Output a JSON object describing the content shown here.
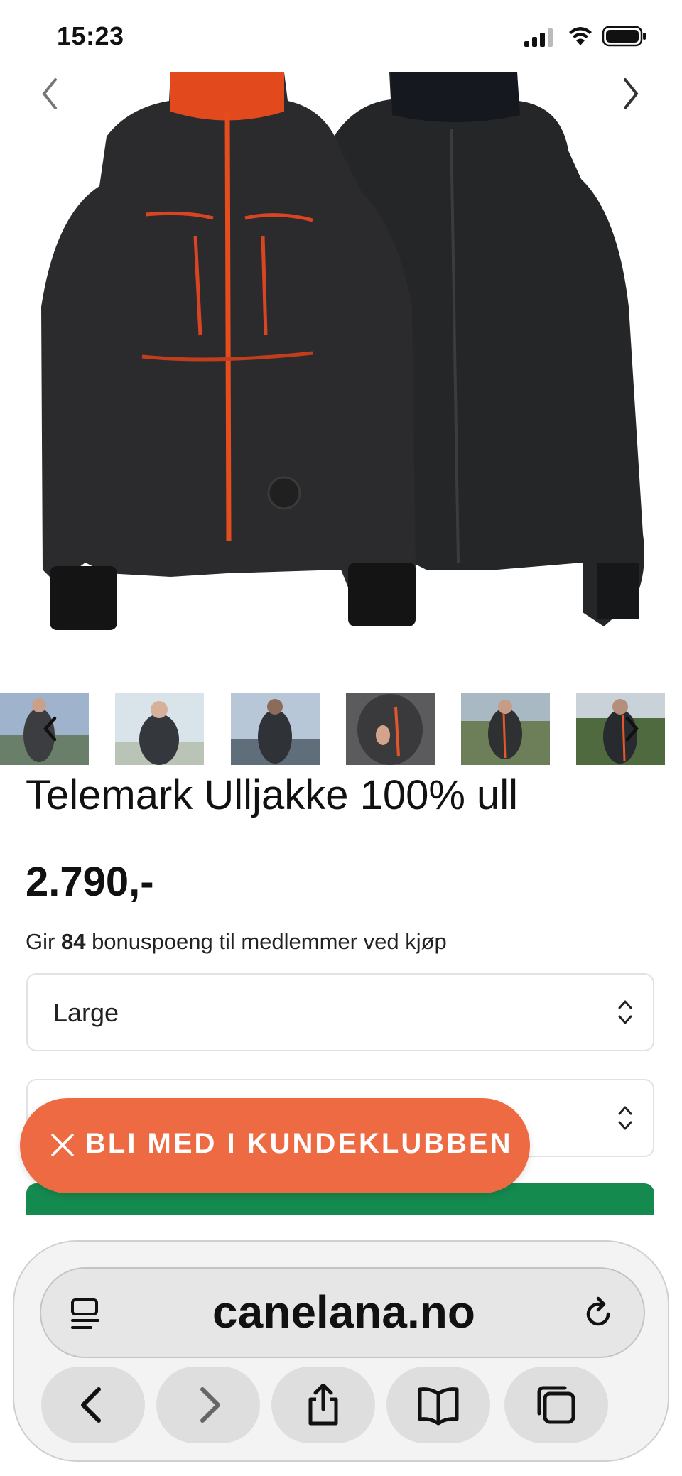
{
  "status_bar": {
    "time": "15:23",
    "icons": [
      "signal-icon",
      "wifi-icon",
      "battery-icon"
    ]
  },
  "product": {
    "title": "Telemark Ulljakke 100% ull",
    "price": "2.790,-",
    "bonus_prefix": "Gir",
    "bonus_points": "84",
    "bonus_suffix": "bonuspoeng til medlemmer ved kjøp",
    "size_select_value": "Large",
    "second_select_value": ""
  },
  "gallery": {
    "thumbnail_count": 6
  },
  "club_button": {
    "label": "BLI MED I KUNDEKLUBBEN",
    "color": "#ee6a43"
  },
  "add_to_cart": {
    "color": "#158a4f"
  },
  "browser": {
    "url": "canelana.no",
    "toolbar": [
      "back-icon",
      "forward-icon",
      "share-icon",
      "bookmarks-icon",
      "tabs-icon"
    ]
  }
}
